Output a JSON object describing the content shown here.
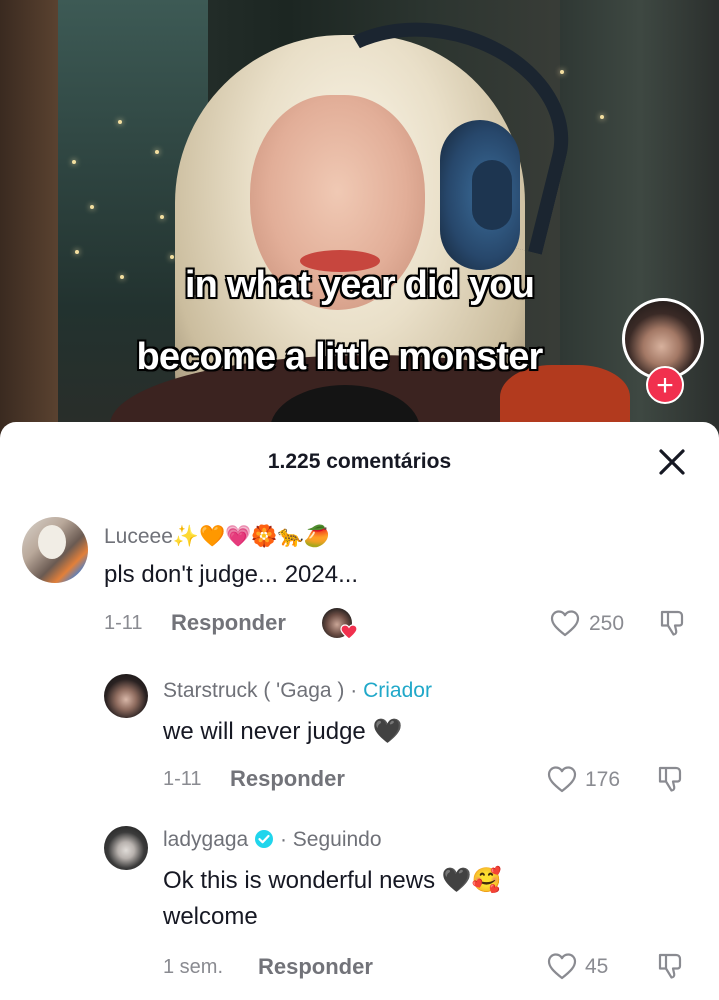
{
  "video": {
    "caption_line1": "in what year did you",
    "caption_line2": "become a little monster",
    "follow_icon": "plus-icon",
    "follow_symbol": "+",
    "accent_color": "#f1304e"
  },
  "comments_sheet": {
    "title": "1.225 comentários",
    "close_icon": "close-icon"
  },
  "comments": [
    {
      "username": "Luceee",
      "username_emojis": "✨🧡💗🏵️🐆🥭",
      "text": "pls don't judge... 2024...",
      "time": "1-11",
      "reply_label": "Responder",
      "likes": "250"
    },
    {
      "username": "Starstruck ( 'Gaga )",
      "separator": "·",
      "tag": "Criador",
      "text": "we will never judge",
      "text_emoji": "🖤",
      "time": "1-11",
      "reply_label": "Responder",
      "likes": "176"
    },
    {
      "username": "ladygaga",
      "verified_icon": "verified-badge-icon",
      "separator": "·",
      "tag": "Seguindo",
      "text_line1": "Ok this is wonderful news",
      "text_emoji": "🖤🥰",
      "text_line2": "welcome",
      "time": "1 sem.",
      "reply_label": "Responder",
      "likes": "45"
    }
  ],
  "colors": {
    "creator_tag": "#20a8c9",
    "verified": "#20d5ec",
    "text_primary": "#161823",
    "text_secondary": "#8a8b91"
  }
}
